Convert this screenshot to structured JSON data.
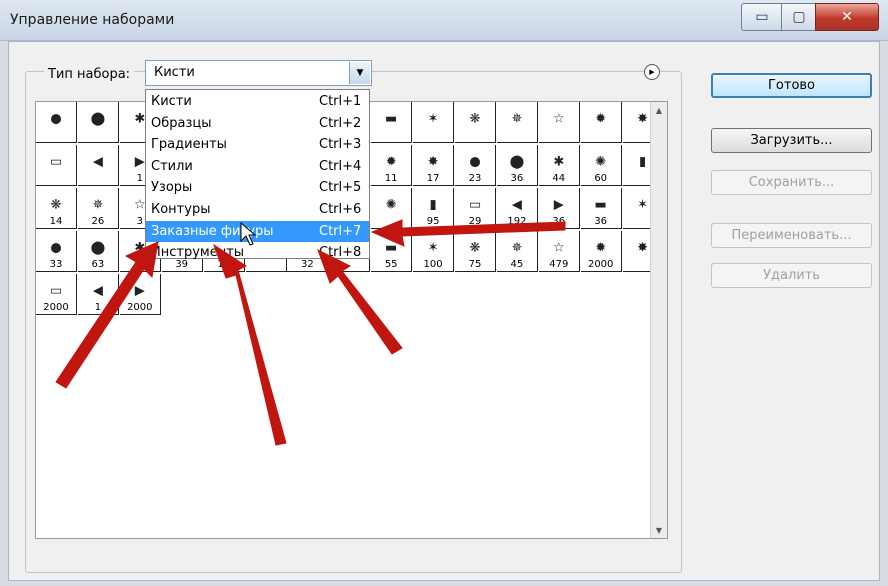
{
  "window": {
    "title": "Управление наборами",
    "min_icon": "▭",
    "max_icon": "▢",
    "close_icon": "✕"
  },
  "preset_type": {
    "label": "Тип набора:",
    "value": "Кисти",
    "arrow": "▼"
  },
  "panel_menu_icon": "▶",
  "dropdown": {
    "items": [
      {
        "label": "Кисти",
        "shortcut": "Ctrl+1"
      },
      {
        "label": "Образцы",
        "shortcut": "Ctrl+2"
      },
      {
        "label": "Градиенты",
        "shortcut": "Ctrl+3"
      },
      {
        "label": "Стили",
        "shortcut": "Ctrl+4"
      },
      {
        "label": "Узоры",
        "shortcut": "Ctrl+5"
      },
      {
        "label": "Контуры",
        "shortcut": "Ctrl+6"
      },
      {
        "label": "Заказные фигуры",
        "shortcut": "Ctrl+7",
        "selected": true
      },
      {
        "label": "Инструменты",
        "shortcut": "Ctrl+8"
      }
    ]
  },
  "brush_grid": {
    "rows": [
      [
        "",
        "",
        "",
        "",
        "",
        "",
        "",
        "",
        "",
        "",
        "",
        "",
        "",
        "",
        ""
      ],
      [
        "",
        "",
        "1",
        "",
        "",
        "",
        "",
        "",
        "11",
        "17",
        "23",
        "36",
        "44",
        "60",
        ""
      ],
      [
        "14",
        "26",
        "3",
        "",
        "",
        "",
        "",
        "",
        "",
        "95",
        "29",
        "192",
        "36",
        "36",
        ""
      ],
      [
        "33",
        "63",
        "",
        "39",
        "11",
        "",
        "32",
        "",
        "55",
        "100",
        "75",
        "45",
        "479",
        "2000",
        ""
      ],
      [
        "2000",
        "1",
        "2000"
      ]
    ]
  },
  "scroll": {
    "up": "▲",
    "down": "▼"
  },
  "buttons": {
    "done": "Готово",
    "load": "Загрузить...",
    "save": "Сохранить...",
    "rename": "Переименовать...",
    "delete": "Удалить"
  },
  "accent_colors": {
    "selection": "#3399ff",
    "annotation_arrows": "#c0160f"
  }
}
